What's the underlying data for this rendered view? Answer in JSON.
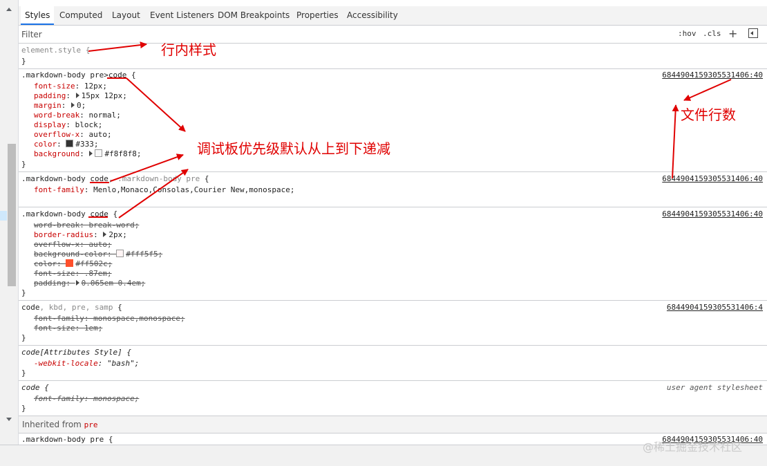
{
  "tabs": [
    "Styles",
    "Computed",
    "Layout",
    "Event Listeners",
    "DOM Breakpoints",
    "Properties",
    "Accessibility"
  ],
  "filter": {
    "placeholder": "Filter",
    "hov": ":hov",
    "cls": ".cls",
    "plus": "+"
  },
  "rules": {
    "element_style": {
      "selector": "element.style {",
      "close": "}"
    },
    "r1": {
      "selector_a": ".markdown-body pre>",
      "selector_b": "code",
      "selector_c": " {",
      "source": "6844904159305531406:40",
      "props": [
        {
          "name": "font-size",
          "value": "12px;"
        },
        {
          "name": "padding",
          "value": "15px 12px;"
        },
        {
          "name": "margin",
          "value": "0;"
        },
        {
          "name": "word-break",
          "value": "normal;"
        },
        {
          "name": "display",
          "value": "block;"
        },
        {
          "name": "overflow-x",
          "value": "auto;"
        },
        {
          "name": "color",
          "value": "#333;"
        },
        {
          "name": "background",
          "value": "#f8f8f8;"
        }
      ],
      "swatch_colors": [
        "#333333",
        "#f8f8f8"
      ],
      "close": "}"
    },
    "r2": {
      "selector_a": ".markdown-body ",
      "selector_b": "code",
      "selector_c": ", ",
      "selector_d": ".markdown-body pre",
      "selector_e": " {",
      "source": "6844904159305531406:40",
      "props": [
        {
          "name": "font-family",
          "value": "Menlo,Monaco,Consolas,Courier New,monospace;"
        }
      ],
      "close": "}"
    },
    "r3": {
      "selector_a": ".markdown-body ",
      "selector_b": "code",
      "selector_c": " {",
      "source": "6844904159305531406:40",
      "props": [
        {
          "name": "word-break",
          "value": "break-word;"
        },
        {
          "name": "border-radius",
          "value": "2px;"
        },
        {
          "name": "overflow-x",
          "value": "auto;"
        },
        {
          "name": "background-color",
          "value": "#fff5f5;"
        },
        {
          "name": "color",
          "value": "#ff502c;"
        },
        {
          "name": "font-size",
          "value": ".87em;"
        },
        {
          "name": "padding",
          "value": "0.065em 0.4em;"
        }
      ],
      "swatch_colors": [
        "#fff5f5",
        "#ff502c"
      ],
      "close": "}"
    },
    "r4": {
      "selector_a": "code",
      "selector_b": ", kbd, pre, samp",
      "selector_c": " {",
      "source": "6844904159305531406:4",
      "props": [
        {
          "name": "font-family",
          "value": "monospace,monospace;"
        },
        {
          "name": "font-size",
          "value": "1em;"
        }
      ],
      "close": "}"
    },
    "r5": {
      "selector": "code[Attributes Style] {",
      "props": [
        {
          "name": "-webkit-locale",
          "value": "\"bash\";"
        }
      ],
      "close": "}"
    },
    "r6": {
      "selector": "code {",
      "source": "user agent stylesheet",
      "props": [
        {
          "name": "font-family",
          "value": "monospace;"
        }
      ],
      "close": "}"
    },
    "r7": {
      "selector": ".markdown-body pre {",
      "source": "6844904159305531406:40"
    }
  },
  "inherited": {
    "label": "Inherited from ",
    "tag": "pre"
  },
  "annotations": {
    "inline_style": "行内样式",
    "priority": "调试板优先级默认从上到下递减",
    "file_line": "文件行数",
    "color": "#e00000"
  },
  "watermark": "@稀土掘金技术社区"
}
